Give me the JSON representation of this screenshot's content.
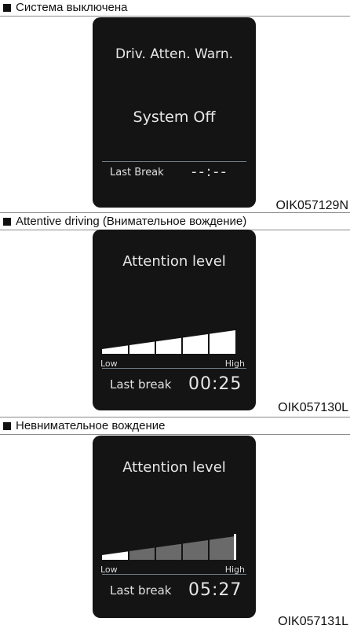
{
  "panels": [
    {
      "caption": "Система выключена",
      "header": "Driv. Atten. Warn.",
      "status": "System Off",
      "last_break_label": "Last Break",
      "last_break_value": "--:--",
      "code": "OIK057129N"
    },
    {
      "caption": "Attentive driving (Внимательное вождение)",
      "header": "Attention level",
      "low_label": "Low",
      "high_label": "High",
      "attention_level": 1.0,
      "last_break_label": "Last break",
      "last_break_value": "00:25",
      "code": "OIK057130L"
    },
    {
      "caption": "Невнимательное вождение",
      "header": "Attention level",
      "low_label": "Low",
      "high_label": "High",
      "attention_level": 0.2,
      "last_break_label": "Last break",
      "last_break_value": "05:27",
      "code": "OIK057131L"
    }
  ],
  "colors": {
    "screen_bg": "#141414",
    "bar_active": "#ffffff",
    "bar_inactive": "#6a6a6a"
  }
}
